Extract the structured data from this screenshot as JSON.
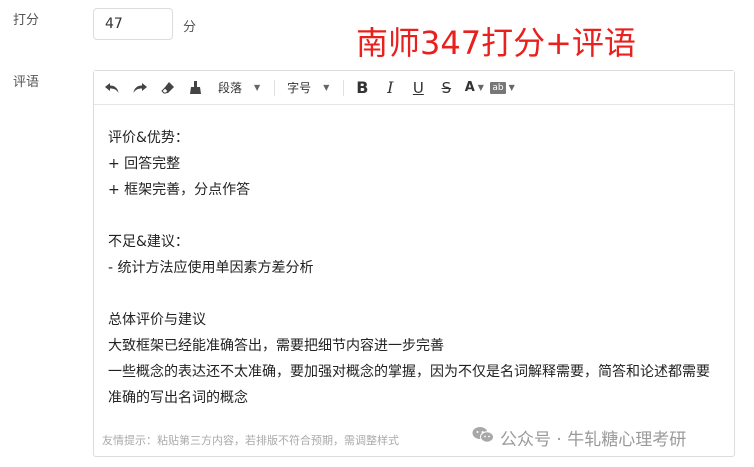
{
  "score": {
    "label": "打分",
    "value": "47",
    "unit": "分"
  },
  "overlay_title": "南师347打分+评语",
  "comment": {
    "label": "评语",
    "toolbar": {
      "paragraph_select": "段落",
      "font_size_select": "字号",
      "bold": "B",
      "italic": "I",
      "underline": "U",
      "strike": "S",
      "font_color": "A",
      "highlight": "ab"
    },
    "lines": [
      "评价&优势：",
      "+ 回答完整",
      "+ 框架完善，分点作答",
      "",
      "不足&建议：",
      "- 统计方法应使用单因素方差分析",
      "",
      "总体评价与建议",
      "大致框架已经能准确答出，需要把细节内容进一步完善",
      "一些概念的表达还不太准确，要加强对概念的掌握，因为不仅是名词解释需要，简答和论述都需要准确的写出名词的概念"
    ],
    "tip": "友情提示：粘贴第三方内容，若排版不符合预期，需调整样式"
  },
  "watermark": {
    "text": "公众号 · 牛轧糖心理考研",
    "icon": "wechat-icon"
  },
  "colors": {
    "title_red": "#e8201e",
    "border": "#dcdcdc",
    "tip": "#aaaaaa"
  }
}
